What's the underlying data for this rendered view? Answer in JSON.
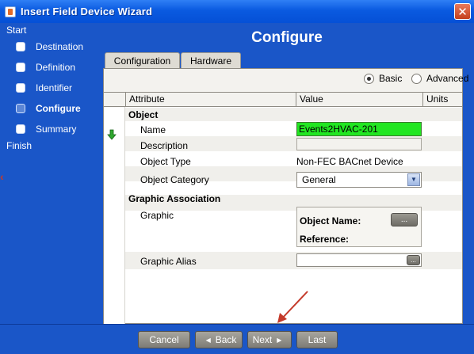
{
  "window": {
    "title": "Insert Field Device Wizard",
    "close_glyph": "✕"
  },
  "sidebar": {
    "start_label": "Start",
    "finish_label": "Finish",
    "steps": [
      {
        "label": "Destination",
        "active": false
      },
      {
        "label": "Definition",
        "active": false
      },
      {
        "label": "Identifier",
        "active": false
      },
      {
        "label": "Configure",
        "active": true
      },
      {
        "label": "Summary",
        "active": false
      }
    ]
  },
  "main": {
    "title": "Configure",
    "tabs": [
      {
        "label": "Configuration",
        "selected": true
      },
      {
        "label": "Hardware",
        "selected": false
      }
    ],
    "mode": {
      "basic_label": "Basic",
      "advanced_label": "Advanced",
      "selected": "Basic"
    },
    "table": {
      "columns": [
        "Attribute",
        "Value",
        "Units"
      ],
      "groups": {
        "object": "Object",
        "graphic_association": "Graphic Association"
      },
      "rows": {
        "name": {
          "attribute": "Name",
          "value": "Events2HVAC-201"
        },
        "description": {
          "attribute": "Description",
          "value": ""
        },
        "object_type": {
          "attribute": "Object Type",
          "value": "Non-FEC BACnet Device"
        },
        "object_category": {
          "attribute": "Object Category",
          "value": "General"
        },
        "graphic": {
          "attribute": "Graphic",
          "object_name_label": "Object Name:",
          "reference_label": "Reference:",
          "browse_label": "..."
        },
        "graphic_alias": {
          "attribute": "Graphic Alias",
          "value": "",
          "browse_label": "..."
        }
      }
    }
  },
  "footer": {
    "cancel": "Cancel",
    "back": "Back",
    "next": "Next",
    "last": "Last"
  },
  "colors": {
    "window_blue": "#1a56c8",
    "name_field_green": "#22e622",
    "annotation_red": "#c43a2a"
  },
  "icons": {
    "modified_indicator": "green-down-arrow-icon",
    "annotation": "red-pointer-arrow"
  }
}
